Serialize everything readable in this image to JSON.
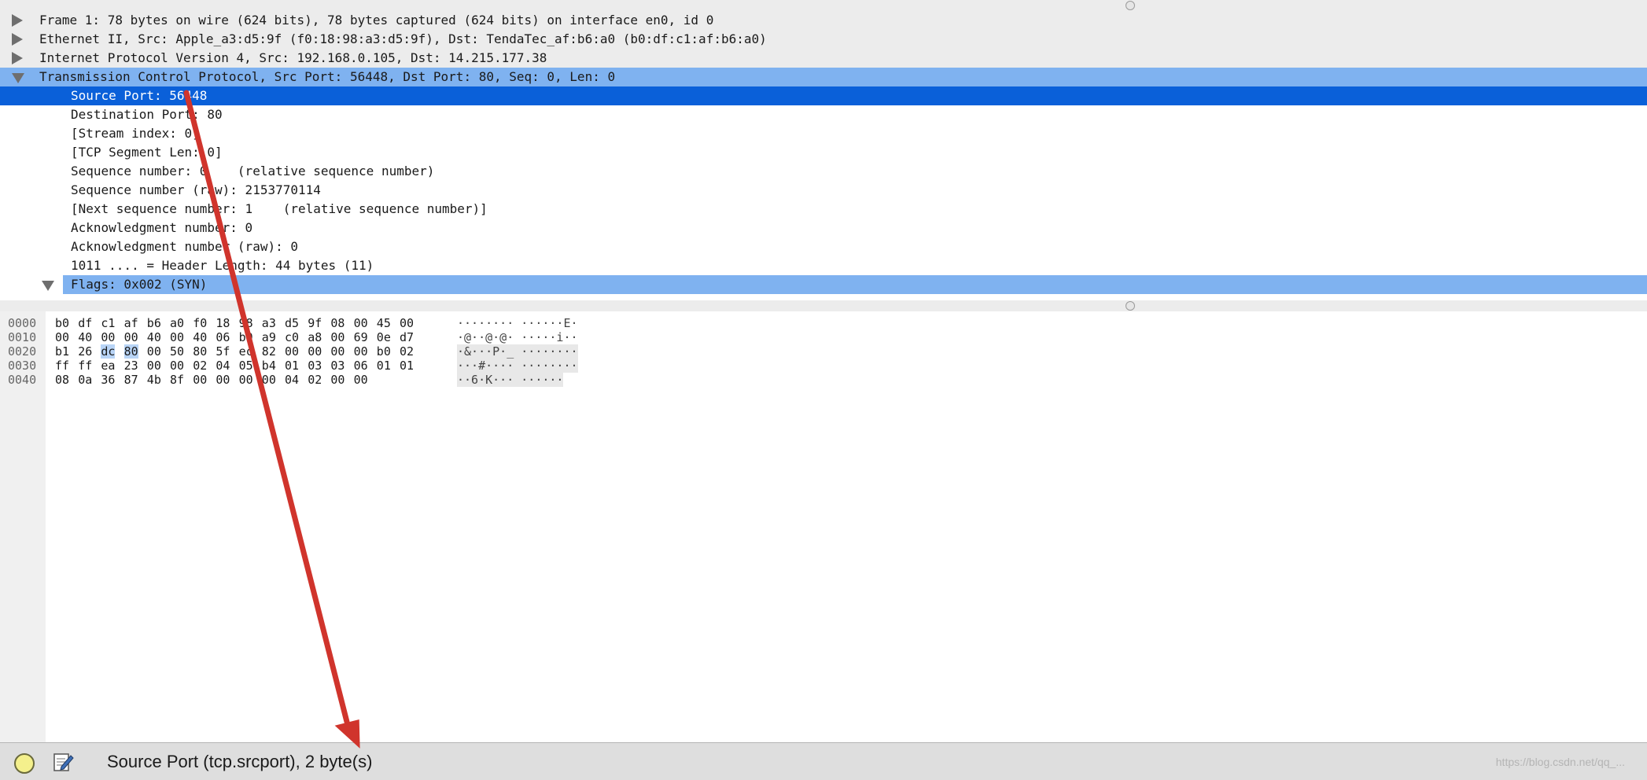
{
  "tree": {
    "rows": [
      {
        "text": "Frame 1: 78 bytes on wire (624 bits), 78 bytes captured (624 bits) on interface en0, id 0",
        "expander": "collapsed"
      },
      {
        "text": "Ethernet II, Src: Apple_a3:d5:9f (f0:18:98:a3:d5:9f), Dst: TendaTec_af:b6:a0 (b0:df:c1:af:b6:a0)",
        "expander": "collapsed"
      },
      {
        "text": "Internet Protocol Version 4, Src: 192.168.0.105, Dst: 14.215.177.38",
        "expander": "collapsed"
      },
      {
        "text": "Transmission Control Protocol, Src Port: 56448, Dst Port: 80, Seq: 0, Len: 0",
        "expander": "expanded",
        "selected": "parent"
      },
      {
        "text": "Source Port: 56448",
        "selected": "current"
      },
      {
        "text": "Destination Port: 80"
      },
      {
        "text": "[Stream index: 0]"
      },
      {
        "text": "[TCP Segment Len: 0]"
      },
      {
        "text": "Sequence number: 0    (relative sequence number)"
      },
      {
        "text": "Sequence number (raw): 2153770114"
      },
      {
        "text": "[Next sequence number: 1    (relative sequence number)]"
      },
      {
        "text": "Acknowledgment number: 0"
      },
      {
        "text": "Acknowledgment number (raw): 0"
      },
      {
        "text": "1011 .... = Header Length: 44 bytes (11)"
      },
      {
        "text": "Flags: 0x002 (SYN)",
        "expander": "expanded",
        "selected": "parent"
      }
    ]
  },
  "hex": {
    "lines": [
      {
        "offset": "0000",
        "bytes": [
          "b0",
          "df",
          "c1",
          "af",
          "b6",
          "a0",
          "f0",
          "18",
          "98",
          "a3",
          "d5",
          "9f",
          "08",
          "00",
          "45",
          "00"
        ],
        "ascii": "········ ······E·",
        "ascii_bg": false
      },
      {
        "offset": "0010",
        "bytes": [
          "00",
          "40",
          "00",
          "00",
          "40",
          "00",
          "40",
          "06",
          "b9",
          "a9",
          "c0",
          "a8",
          "00",
          "69",
          "0e",
          "d7"
        ],
        "ascii": "·@··@·@· ·····i··",
        "ascii_bg": false
      },
      {
        "offset": "0020",
        "bytes": [
          "b1",
          "26",
          "dc",
          "80",
          "00",
          "50",
          "80",
          "5f",
          "ec",
          "82",
          "00",
          "00",
          "00",
          "00",
          "b0",
          "02"
        ],
        "ascii": "·&···P·_ ········",
        "ascii_bg": true,
        "selected_bytes": [
          2,
          3
        ]
      },
      {
        "offset": "0030",
        "bytes": [
          "ff",
          "ff",
          "ea",
          "23",
          "00",
          "00",
          "02",
          "04",
          "05",
          "b4",
          "01",
          "03",
          "03",
          "06",
          "01",
          "01"
        ],
        "ascii": "···#···· ········",
        "ascii_bg": true
      },
      {
        "offset": "0040",
        "bytes": [
          "08",
          "0a",
          "36",
          "87",
          "4b",
          "8f",
          "00",
          "00",
          "00",
          "00",
          "04",
          "02",
          "00",
          "00"
        ],
        "ascii": "··6·K··· ······",
        "ascii_bg": true
      }
    ]
  },
  "status": {
    "indicator_icon": "status-led-icon",
    "edit_icon": "expert-info-edit-icon",
    "text": "Source Port (tcp.srcport), 2 byte(s)",
    "watermark": "https://blog.csdn.net/qq_..."
  },
  "colors": {
    "selected_row": "#0a60d9",
    "selected_parent_row": "#7fb2f0",
    "byte_selection": "#b8d4f6",
    "annotation_arrow": "#d0342c"
  }
}
